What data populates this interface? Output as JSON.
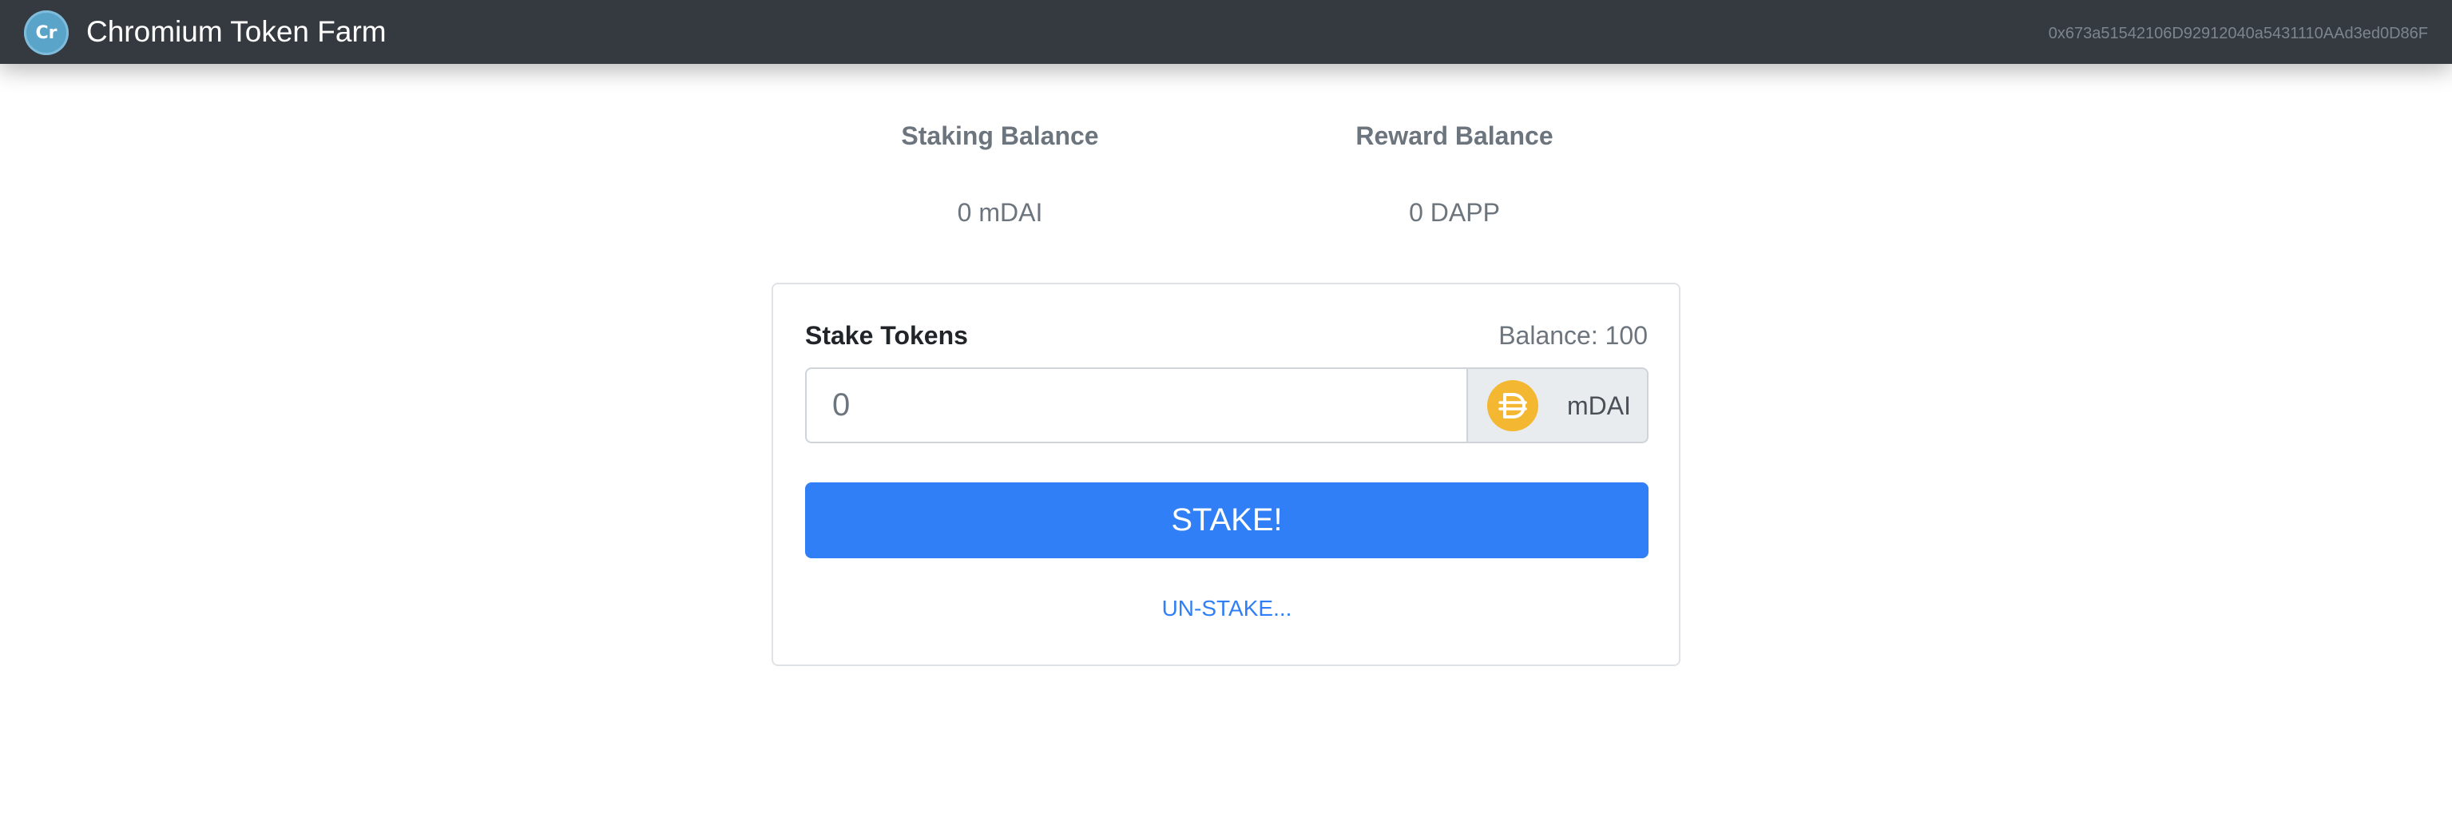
{
  "navbar": {
    "logo_text": "Cr",
    "title": "Chromium Token Farm",
    "account": "0x673a51542106D92912040a5431110AAd3ed0D86F",
    "background": "#343a40"
  },
  "balances": {
    "staking": {
      "heading": "Staking Balance",
      "value": "0 mDAI"
    },
    "reward": {
      "heading": "Reward Balance",
      "value": "0 DAPP"
    }
  },
  "stake_form": {
    "label": "Stake Tokens",
    "balance_text": "Balance: 100",
    "amount_placeholder": "0",
    "amount_value": "",
    "token_icon": "dai-icon",
    "token_label": "mDAI",
    "stake_button_label": "STAKE!",
    "unstake_link_label": "UN-STAKE..."
  },
  "colors": {
    "accent": "#307ff6",
    "token_icon": "#f4b731",
    "muted_text": "#6c757d"
  }
}
